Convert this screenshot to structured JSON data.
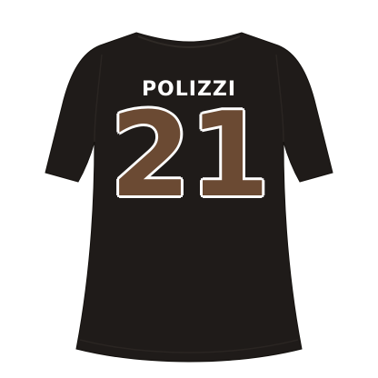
{
  "jersey": {
    "name": "POLIZZI",
    "number": "21"
  },
  "colors": {
    "background": "#ffffff",
    "shirt": "#1f1b19",
    "shirt_seam": "#2a2522",
    "name_text": "#ffffff",
    "number_fill": "#6b4a33",
    "number_outline": "#ffffff"
  }
}
